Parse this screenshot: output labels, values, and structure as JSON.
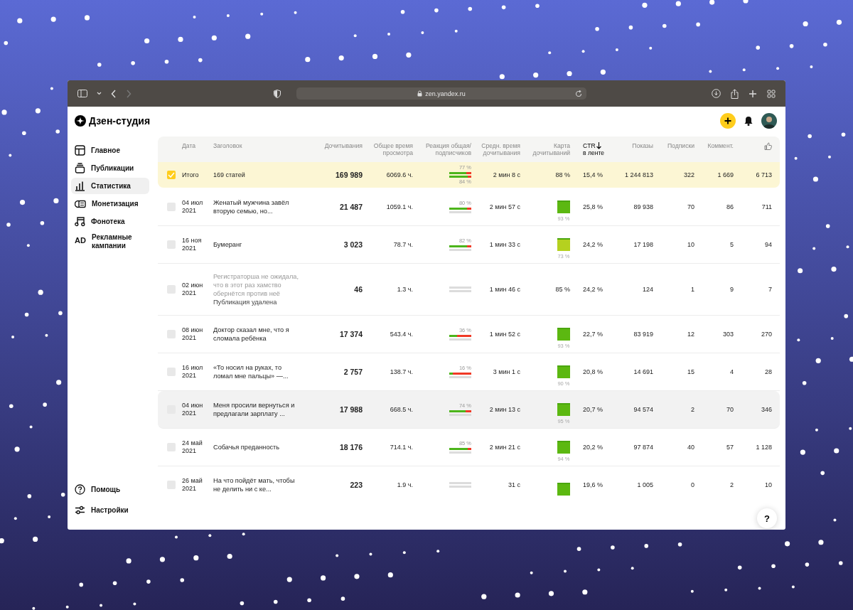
{
  "browser": {
    "url": "zen.yandex.ru"
  },
  "app": {
    "logo": "Дзен-студия"
  },
  "sidebar": {
    "items": [
      {
        "label": "Главное",
        "selected": false
      },
      {
        "label": "Публикации",
        "selected": false
      },
      {
        "label": "Статистика",
        "selected": true
      },
      {
        "label": "Монетизация",
        "selected": false
      },
      {
        "label": "Фонотека",
        "selected": false
      },
      {
        "label": "Рекламные кампании",
        "badge": "AD",
        "selected": false
      }
    ],
    "bottom": [
      {
        "label": "Помощь"
      },
      {
        "label": "Настройки"
      }
    ]
  },
  "table": {
    "columns": [
      {
        "label": "Дата",
        "sorted": false
      },
      {
        "label": "Заголовок",
        "sorted": false
      },
      {
        "label": "Дочитывания",
        "sorted": false
      },
      {
        "label": "Общее время просмотра",
        "sorted": false
      },
      {
        "label": "Реакция общая/ подписчиков",
        "sorted": false
      },
      {
        "label": "Средн. время дочитывания",
        "sorted": false
      },
      {
        "label": "Карта дочитываний",
        "sorted": false
      },
      {
        "label": "CTR",
        "sub": "в ленте",
        "sorted": true
      },
      {
        "label": "Показы",
        "sorted": false
      },
      {
        "label": "Подписки",
        "sorted": false
      },
      {
        "label": "Коммент.",
        "sorted": false
      },
      {
        "kind": "likes",
        "sorted": false
      }
    ],
    "total": {
      "checked": true,
      "date": "Итого",
      "title": "169 статей",
      "reads": "169 989",
      "time": "6069.6 ч.",
      "reaction": {
        "total": {
          "label": "77 %",
          "level": 0.77
        },
        "subs": {
          "label": "84 %",
          "level": 0.84
        }
      },
      "avg": "2 мин 8 с",
      "map": {
        "kind": "text",
        "label": "88 %"
      },
      "ctr": "15,4 %",
      "shows": "1 244 813",
      "subs": "322",
      "comments": "1 669",
      "likes": "6 713"
    },
    "rows": [
      {
        "checked": false,
        "hovered": false,
        "date": "04 июл 2021",
        "title": "Женатый мужчина завёл вторую семью, но...",
        "deleted": false,
        "reads": "21 487",
        "time": "1059.1 ч.",
        "reaction": {
          "total": {
            "label": "80 %",
            "level": 0.8
          }
        },
        "avg": "2 мин 57 с",
        "map": {
          "kind": "square",
          "label": "93 %",
          "color": "#5cb811"
        },
        "ctr": "25,8 %",
        "shows": "89 938",
        "subs": "70",
        "comments": "86",
        "likes": "711"
      },
      {
        "checked": false,
        "hovered": false,
        "date": "16 ноя 2021",
        "title": "Бумеранг",
        "deleted": false,
        "reads": "3 023",
        "time": "78.7 ч.",
        "reaction": {
          "total": {
            "label": "82 %",
            "level": 0.82
          }
        },
        "avg": "1 мин 33 с",
        "map": {
          "kind": "square",
          "label": "73 %",
          "color": "#b5d11f"
        },
        "ctr": "24,2 %",
        "shows": "17 198",
        "subs": "10",
        "comments": "5",
        "likes": "94"
      },
      {
        "checked": false,
        "hovered": false,
        "date": "02 июн 2021",
        "title": "Регистраторша не ожидала, что в этот раз хамство обернётся против неё",
        "deleted": true,
        "note": "Публикация удалена",
        "reads": "46",
        "time": "1.3 ч.",
        "reaction": {},
        "avg": "1 мин 46 с",
        "map": {
          "kind": "text",
          "label": "85 %"
        },
        "ctr": "24,2 %",
        "shows": "124",
        "subs": "1",
        "comments": "9",
        "likes": "7"
      },
      {
        "checked": false,
        "hovered": false,
        "date": "08 июн 2021",
        "title": "Доктор сказал мне, что я сломала ребёнка",
        "deleted": false,
        "reads": "17 374",
        "time": "543.4 ч.",
        "reaction": {
          "total": {
            "label": "36 %",
            "level": 0.36
          }
        },
        "avg": "1 мин 52 с",
        "map": {
          "kind": "square",
          "label": "93 %",
          "color": "#5cb811"
        },
        "ctr": "22,7 %",
        "shows": "83 919",
        "subs": "12",
        "comments": "303",
        "likes": "270"
      },
      {
        "checked": false,
        "hovered": false,
        "date": "16 июл 2021",
        "title": "«То носил на руках, то ломал мне пальцы» —...",
        "deleted": false,
        "reads": "2 757",
        "time": "138.7 ч.",
        "reaction": {
          "total": {
            "label": "16 %",
            "level": 0.16
          }
        },
        "avg": "3 мин 1 с",
        "map": {
          "kind": "square",
          "label": "90 %",
          "color": "#5cb811"
        },
        "ctr": "20,8 %",
        "shows": "14 691",
        "subs": "15",
        "comments": "4",
        "likes": "28"
      },
      {
        "checked": false,
        "hovered": true,
        "date": "04 июн 2021",
        "title": "Меня просили вернуться и предлагали зарплату ...",
        "deleted": false,
        "reads": "17 988",
        "time": "668.5 ч.",
        "reaction": {
          "total": {
            "label": "74 %",
            "level": 0.74
          }
        },
        "avg": "2 мин 13 с",
        "map": {
          "kind": "square",
          "label": "95 %",
          "color": "#5cb811"
        },
        "ctr": "20,7 %",
        "shows": "94 574",
        "subs": "2",
        "comments": "70",
        "likes": "346"
      },
      {
        "checked": false,
        "hovered": false,
        "date": "24 май 2021",
        "title": "Собачья преданность",
        "deleted": false,
        "reads": "18 176",
        "time": "714.1 ч.",
        "reaction": {
          "total": {
            "label": "85 %",
            "level": 0.85
          }
        },
        "avg": "2 мин 21 с",
        "map": {
          "kind": "square",
          "label": "94 %",
          "color": "#5cb811"
        },
        "ctr": "20,2 %",
        "shows": "97 874",
        "subs": "40",
        "comments": "57",
        "likes": "1 128"
      },
      {
        "checked": false,
        "hovered": false,
        "date": "26 май 2021",
        "title": "На что пойдёт мать, чтобы не делить ни с ке...",
        "deleted": false,
        "reads": "223",
        "time": "1.9 ч.",
        "reaction": {},
        "avg": "31 с",
        "map": {
          "kind": "square",
          "color": "#5cb811"
        },
        "ctr": "19,6 %",
        "shows": "1 005",
        "subs": "0",
        "comments": "2",
        "likes": "10"
      }
    ]
  },
  "help_button": "?"
}
